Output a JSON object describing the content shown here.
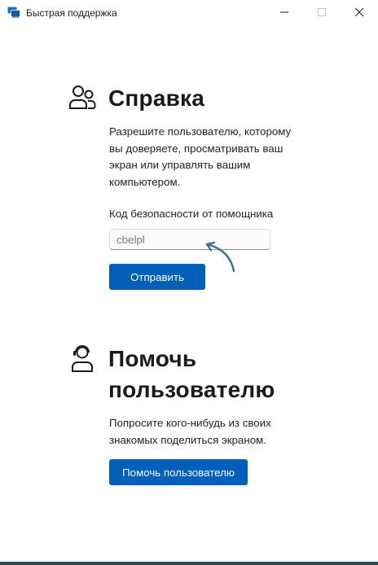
{
  "window": {
    "title": "Быстрая поддержка",
    "icons": {
      "app": "quick-assist-icon",
      "minimize": "minimize-icon",
      "maximize": "maximize-icon",
      "close": "close-icon"
    }
  },
  "get_help": {
    "icon": "people-icon",
    "heading": "Справка",
    "description_lines": [
      "Разрешите пользователю, которому",
      "вы доверяете, просматривать ваш",
      "экран или управлять вашим",
      "компьютером."
    ],
    "code_label": "Код безопасности от помощника",
    "code_value": "cbelpl",
    "submit_label": "Отправить"
  },
  "give_help": {
    "icon": "person-headset-icon",
    "heading_lines": [
      "Помочь",
      "пользователю"
    ],
    "description_lines": [
      "Попросите кого-нибудь из своих",
      "знакомых поделиться экраном."
    ],
    "button_label": "Помочь пользователю"
  },
  "colors": {
    "accent": "#005fb8",
    "arrow": "#3a6f9a",
    "text": "#1a1a1a"
  }
}
